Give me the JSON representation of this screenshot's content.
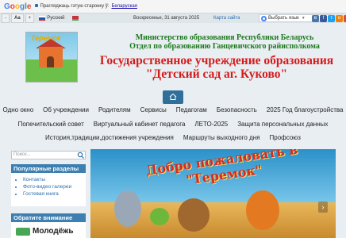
{
  "translate_bar": {
    "logo": "Google",
    "text": "Прагляджаць гэтую старонку ў:",
    "language_link": "Беларуская"
  },
  "toolbar": {
    "font_minus": "-",
    "font_aa": "Aa",
    "font_plus": "+",
    "lang_ru": "Русский",
    "date": "Воскресенье, 31 августа 2025",
    "site_map": "Карта сайта",
    "translate_select": "Выбрать язык",
    "translate_arrow": "▼"
  },
  "social": [
    {
      "name": "vk-icon",
      "glyph": "в",
      "color": "#4a76a8"
    },
    {
      "name": "facebook-icon",
      "glyph": "f",
      "color": "#3b5998"
    },
    {
      "name": "twitter-icon",
      "glyph": "t",
      "color": "#1da1f2"
    },
    {
      "name": "odnoklassniki-icon",
      "glyph": "о",
      "color": "#ee8208"
    },
    {
      "name": "googleplus-icon",
      "glyph": "g",
      "color": "#dd4b39"
    }
  ],
  "header": {
    "logo_text": "Теремок",
    "ministry_line1": "Министерство образования Республики Беларусь",
    "ministry_line2": "Отдел по образованию Ганцевичского райисполкома",
    "title_line1": "Государственное учреждение образования",
    "title_line2": "\"Детский сад аг. Куково\""
  },
  "nav": {
    "home_icon": "home-icon",
    "row1": [
      "Одно окно",
      "Об учреждении",
      "Родителям",
      "Сервисы",
      "Педагогам",
      "Безопасность",
      "2025 Год благоустройства"
    ],
    "row2": [
      "Попечительский совет",
      "Виртуальный кабинет педагога",
      "ЛЕТО-2025",
      "Защита персональных данных"
    ],
    "row3": [
      "История,традиции,достижения учреждения",
      "Маршруты выходного дня",
      "Профсоюз"
    ]
  },
  "sidebar": {
    "search_placeholder": "Поиск...",
    "popular_title": "Популярные разделы",
    "popular_items": [
      "Контакты",
      "Фото-видео галереи",
      "Гостевая книга"
    ],
    "attention_title": "Обратите внимание",
    "attention_item": "Молодёжь"
  },
  "banner": {
    "text": "Добро пожаловать в \"Теремок\""
  }
}
